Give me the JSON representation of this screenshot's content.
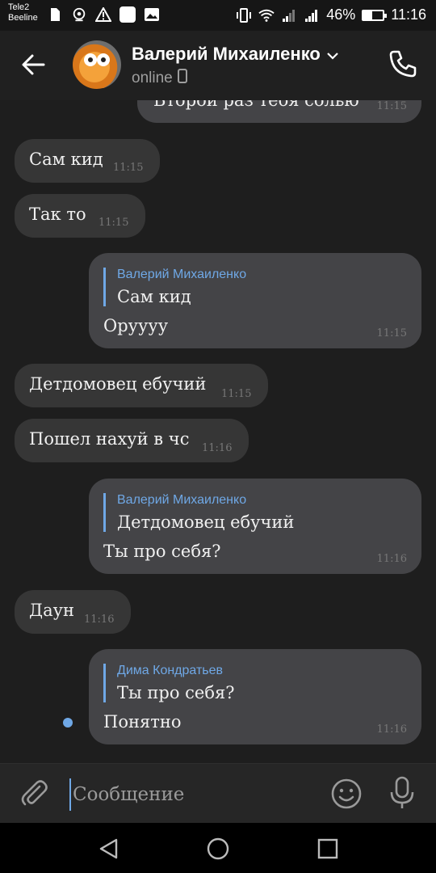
{
  "status_bar": {
    "carrier1": "Tele2",
    "carrier2": "Beeline",
    "battery": "46%",
    "battery_level": 0.46,
    "time": "11:16"
  },
  "header": {
    "name": "Валерий Михаиленко",
    "status": "online"
  },
  "messages": [
    {
      "dir": "out",
      "text": "Второй раз тебя солью",
      "time": "11:15"
    },
    {
      "dir": "in",
      "text": "Сам кид",
      "time": "11:15"
    },
    {
      "dir": "in",
      "text": "Так то",
      "time": "11:15"
    },
    {
      "dir": "out",
      "reply_author": "Валерий Михаиленко",
      "reply_text": "Сам кид",
      "text": "Оруууу",
      "time": "11:15"
    },
    {
      "dir": "in",
      "text": "Детдомовец ебучий",
      "time": "11:15"
    },
    {
      "dir": "in",
      "text": "Пошел нахуй в чс",
      "time": "11:16"
    },
    {
      "dir": "out",
      "reply_author": "Валерий Михаиленко",
      "reply_text": "Детдомовец ебучий",
      "text": "Ты про себя?",
      "time": "11:16"
    },
    {
      "dir": "in",
      "text": "Даун",
      "time": "11:16"
    },
    {
      "dir": "out",
      "reply_author": "Дима Кондратьев",
      "reply_text": "Ты про себя?",
      "text": "Понятно",
      "time": "11:16"
    }
  ],
  "input": {
    "placeholder": "Сообщение"
  },
  "icons": {
    "back": "arrow-left-icon",
    "call": "phone-icon",
    "attach": "paperclip-icon",
    "emoji": "smiley-icon",
    "mic": "microphone-icon"
  },
  "colors": {
    "accent": "#6fa8e6",
    "bubble_in": "#363636",
    "bubble_out": "#444447",
    "background": "#1e1e1e"
  }
}
